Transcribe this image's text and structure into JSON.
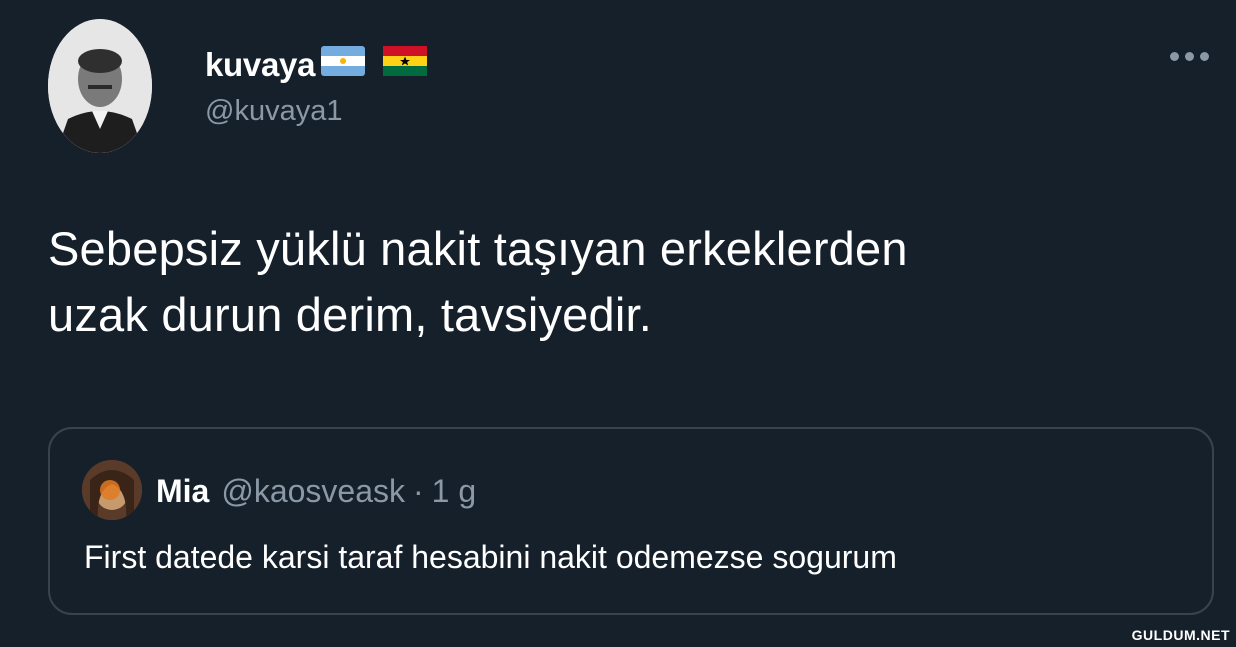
{
  "author": {
    "display_name": "kuvaya",
    "handle": "@kuvaya1",
    "flags": [
      "argentina-flag-icon",
      "ghana-flag-icon"
    ]
  },
  "tweet": {
    "text_line1": "Sebepsiz yüklü nakit taşıyan erkeklerden",
    "text_line2": "uzak durun derim, tavsiyedir."
  },
  "quoted_tweet": {
    "display_name": "Mia",
    "handle": "@kaosveask",
    "separator": "·",
    "time": "1 g",
    "text": "First datede karsi taraf hesabini nakit odemezse sogurum"
  },
  "watermark": "GULDUM.NET",
  "colors": {
    "background": "#15202b",
    "secondary_text": "#8b98a5",
    "border": "#38444d",
    "primary_text": "#ffffff"
  }
}
